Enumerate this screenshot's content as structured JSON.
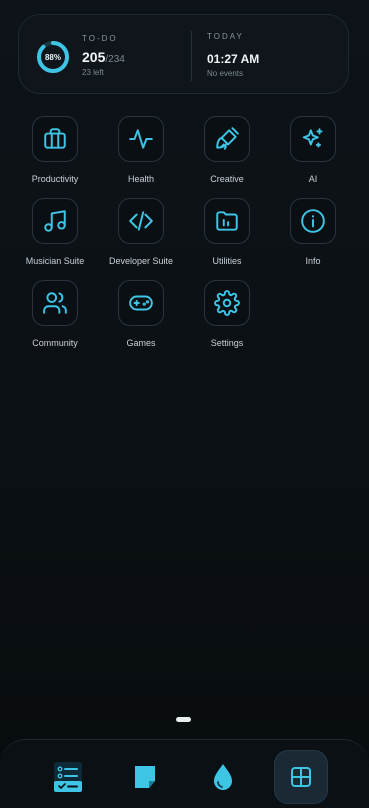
{
  "widget": {
    "progress_label": "88%",
    "progress_fraction": 0.88,
    "todo_title": "TO-DO",
    "todo_count": "205",
    "todo_total": "/234",
    "todo_left": "23 left",
    "today_title": "TODAY",
    "today_time": "01:27 AM",
    "today_events": "No events"
  },
  "apps": [
    {
      "label": "Productivity",
      "icon": "briefcase-icon"
    },
    {
      "label": "Health",
      "icon": "heartbeat-icon"
    },
    {
      "label": "Creative",
      "icon": "paintbrush-icon"
    },
    {
      "label": "AI",
      "icon": "sparkles-icon"
    },
    {
      "label": "Musician Suite",
      "icon": "music-note-icon"
    },
    {
      "label": "Developer Suite",
      "icon": "code-icon"
    },
    {
      "label": "Utilities",
      "icon": "folder-chart-icon"
    },
    {
      "label": "Info",
      "icon": "info-icon"
    },
    {
      "label": "Community",
      "icon": "users-icon"
    },
    {
      "label": "Games",
      "icon": "gamepad-icon"
    },
    {
      "label": "Settings",
      "icon": "gear-icon"
    }
  ],
  "dock": [
    {
      "icon": "task-list-icon"
    },
    {
      "icon": "sticky-note-icon"
    },
    {
      "icon": "water-drop-icon"
    },
    {
      "icon": "grid-icon",
      "active": true
    }
  ],
  "colors": {
    "accent": "#3ec5e6",
    "background": "#0b1014",
    "tile_border": "#2a3540"
  }
}
